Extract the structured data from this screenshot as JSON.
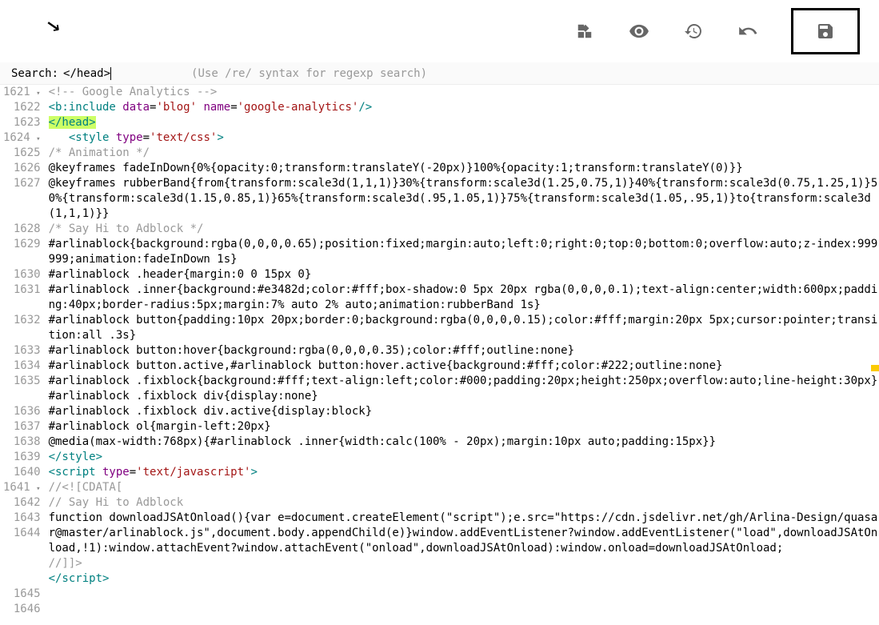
{
  "toolbar": {
    "icons": {
      "widgets": "widgets-icon",
      "preview": "eye-icon",
      "revert": "history-icon",
      "undo": "undo-icon",
      "save": "save-icon"
    }
  },
  "search": {
    "label": "Search:",
    "value": "</head>",
    "hint": "(Use /re/ syntax for regexp search)"
  },
  "lines": [
    {
      "n": 1621,
      "fold": true
    },
    {
      "n": 1622
    },
    {
      "n": 1623
    },
    {
      "n": 1624,
      "fold": true
    },
    {
      "n": 1625
    },
    {
      "n": 1626
    },
    {
      "n": 1627
    },
    {
      "n": 1628
    },
    {
      "n": 1629
    },
    {
      "n": 1630
    },
    {
      "n": 1631
    },
    {
      "n": 1632
    },
    {
      "n": 1633
    },
    {
      "n": 1634
    },
    {
      "n": 1635
    },
    {
      "n": 1636
    },
    {
      "n": 1637
    },
    {
      "n": 1638
    },
    {
      "n": 1639
    },
    {
      "n": 1640
    },
    {
      "n": 1641,
      "fold": true
    },
    {
      "n": 1642
    },
    {
      "n": 1643
    },
    {
      "n": 1644
    },
    {
      "n": 1645
    },
    {
      "n": 1646
    }
  ],
  "code": {
    "l1621": "<!-- Google Analytics -->",
    "l1622_tag_open": "<b:include",
    "l1622_attr1": " data",
    "l1622_eq": "=",
    "l1622_val1": "'blog'",
    "l1622_attr2": " name",
    "l1622_val2": "'google-analytics'",
    "l1622_tag_close": "/>",
    "l1623": "</head>",
    "l1624_indent": "   ",
    "l1624_tag_open": "<style",
    "l1624_attr": " type",
    "l1624_val": "'text/css'",
    "l1624_tag_close": ">",
    "l1625": "/* Animation */",
    "l1626": "@keyframes fadeInDown{0%{opacity:0;transform:translateY(-20px)}100%{opacity:1;transform:translateY(0)}}",
    "l1627": "@keyframes rubberBand{from{transform:scale3d(1,1,1)}30%{transform:scale3d(1.25,0.75,1)}40%{transform:scale3d(0.75,1.25,1)}50%{transform:scale3d(1.15,0.85,1)}65%{transform:scale3d(.95,1.05,1)}75%{transform:scale3d(1.05,.95,1)}to{transform:scale3d(1,1,1)}}",
    "l1628": "/* Say Hi to Adblock */",
    "l1629": "#arlinablock{background:rgba(0,0,0,0.65);position:fixed;margin:auto;left:0;right:0;top:0;bottom:0;overflow:auto;z-index:999999;animation:fadeInDown 1s}",
    "l1630": "#arlinablock .header{margin:0 0 15px 0}",
    "l1631": "#arlinablock .inner{background:#e3482d;color:#fff;box-shadow:0 5px 20px rgba(0,0,0,0.1);text-align:center;width:600px;padding:40px;border-radius:5px;margin:7% auto 2% auto;animation:rubberBand 1s}",
    "l1632": "#arlinablock button{padding:10px 20px;border:0;background:rgba(0,0,0,0.15);color:#fff;margin:20px 5px;cursor:pointer;transition:all .3s}",
    "l1633": "#arlinablock button:hover{background:rgba(0,0,0,0.35);color:#fff;outline:none}",
    "l1634": "#arlinablock button.active,#arlinablock button:hover.active{background:#fff;color:#222;outline:none}",
    "l1635": "#arlinablock .fixblock{background:#fff;text-align:left;color:#000;padding:20px;height:250px;overflow:auto;line-height:30px}",
    "l1636": "#arlinablock .fixblock div{display:none}",
    "l1637": "#arlinablock .fixblock div.active{display:block}",
    "l1638": "#arlinablock ol{margin-left:20px}",
    "l1639": "@media(max-width:768px){#arlinablock .inner{width:calc(100% - 20px);margin:10px auto;padding:15px}}",
    "l1640": "</style>",
    "l1641_tag_open": "<script",
    "l1641_attr": " type",
    "l1641_val": "'text/javascript'",
    "l1641_tag_close": ">",
    "l1642": "//<![CDATA[",
    "l1643": "// Say Hi to Adblock",
    "l1644": "function downloadJSAtOnload(){var e=document.createElement(\"script\");e.src=\"https://cdn.jsdelivr.net/gh/Arlina-Design/quasar@master/arlinablock.js\",document.body.appendChild(e)}window.addEventListener?window.addEventListener(\"load\",downloadJSAtOnload,!1):window.attachEvent?window.attachEvent(\"onload\",downloadJSAtOnload):window.onload=downloadJSAtOnload;",
    "l1645": "//]]>",
    "l1646_text": "/script",
    "l1646_open": "<",
    "l1646_close": ">"
  }
}
